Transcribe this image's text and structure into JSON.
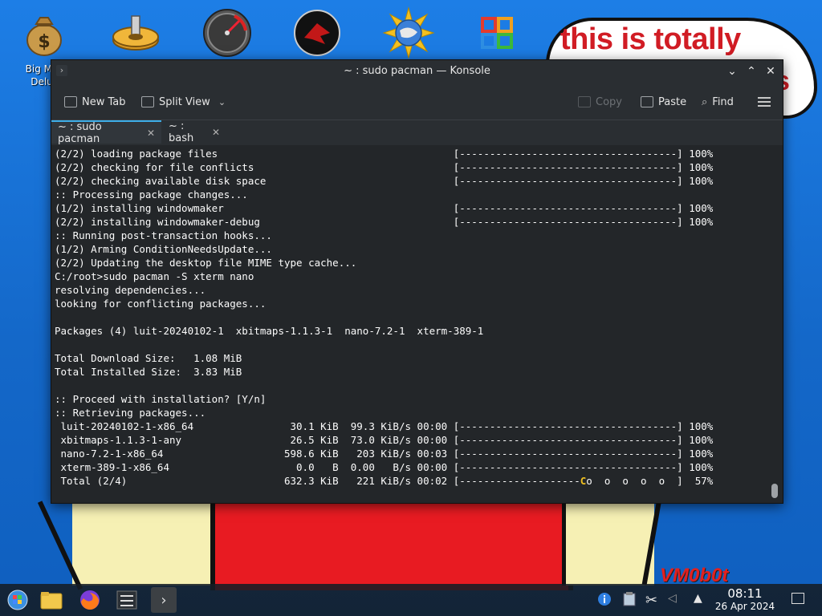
{
  "desktop": {
    "icons": [
      {
        "name": "big-money-deluxe"
      },
      {
        "name": "gear-app"
      },
      {
        "name": "gauge-app"
      },
      {
        "name": "red-app"
      },
      {
        "name": "sun-app"
      },
      {
        "name": "bsd-app"
      }
    ],
    "first_icon_label": "Big Mo Delu",
    "speech_bubble_text": "this is totally",
    "speech_bubble_tail_text": "s",
    "watermark": "VM0b0t"
  },
  "window": {
    "title": "~ : sudo pacman — Konsole",
    "buttons": {
      "minimize": "⌄",
      "maximize": "⌃",
      "close": "✕"
    }
  },
  "toolbar": {
    "new_tab": "New Tab",
    "split_view": "Split View",
    "copy": "Copy",
    "paste": "Paste",
    "find": "Find"
  },
  "tabs": [
    {
      "label": "~ : sudo pacman",
      "active": true
    },
    {
      "label": "~ : bash",
      "active": false
    }
  ],
  "terminal": {
    "lines": [
      "(2/2) loading package files                                       [------------------------------------] 100%",
      "(2/2) checking for file conflicts                                 [------------------------------------] 100%",
      "(2/2) checking available disk space                               [------------------------------------] 100%",
      ":: Processing package changes...",
      "(1/2) installing windowmaker                                      [------------------------------------] 100%",
      "(2/2) installing windowmaker-debug                                [------------------------------------] 100%",
      ":: Running post-transaction hooks...",
      "(1/2) Arming ConditionNeedsUpdate...",
      "(2/2) Updating the desktop file MIME type cache...",
      "C:/root>sudo pacman -S xterm nano",
      "resolving dependencies...",
      "looking for conflicting packages...",
      "",
      "Packages (4) luit-20240102-1  xbitmaps-1.1.3-1  nano-7.2-1  xterm-389-1",
      "",
      "Total Download Size:   1.08 MiB",
      "Total Installed Size:  3.83 MiB",
      "",
      ":: Proceed with installation? [Y/n]",
      ":: Retrieving packages...",
      " luit-20240102-1-x86_64                30.1 KiB  99.3 KiB/s 00:00 [------------------------------------] 100%",
      " xbitmaps-1.1.3-1-any                  26.5 KiB  73.0 KiB/s 00:00 [------------------------------------] 100%",
      " nano-7.2-1-x86_64                    598.6 KiB   203 KiB/s 00:03 [------------------------------------] 100%",
      " xterm-389-1-x86_64                     0.0   B  0.00   B/s 00:00 [------------------------------------] 100%"
    ],
    "total_line_prefix": " Total (2/4)                          632.3 KiB   221 KiB/s 00:02 [--------------------",
    "total_line_cursor": "C",
    "total_line_suffix": "o  o  o  o  o  ]  57%"
  },
  "taskbar": {
    "apps": [
      "start-menu",
      "file-manager",
      "firefox",
      "mixer",
      "konsole"
    ],
    "clock_time": "08:11",
    "clock_date": "26 Apr 2024"
  }
}
